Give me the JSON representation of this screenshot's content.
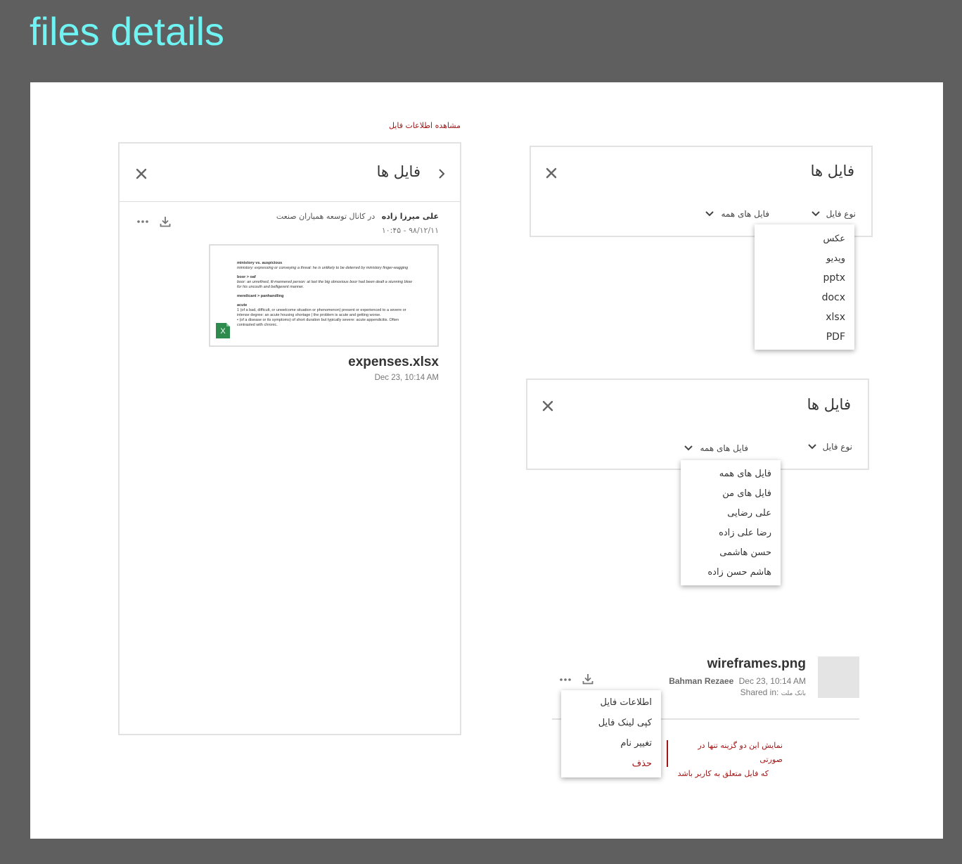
{
  "page_title": "files details",
  "annotation_view_info": "مشاهده اطلاعات فایل",
  "left_panel": {
    "title": "فایل ها",
    "sender_name": "علی میرزا زاده",
    "channel_text": "در کانال توسعه همیاران صنعت",
    "datetime": "۹۸/۱۲/۱۱ - ۱۰:۴۵",
    "preview_lines": [
      "ministory vs. auspicious",
      "ministory: expressing or conveying a threat: he is unlikely to be deterred by ministory finger-wagging",
      "boor > oaf",
      "boor: an unrefined, ill-mannered person: at last the big obnoxious boor had been dealt a stunning blow for his uncouth and belligerent manner.",
      "mendicant > panhandling",
      "acute",
      "1 (of a bad, difficult, or unwelcome situation or phenomenon) present or experienced to a severe or intense degree: an acute housing shortage | the problem is acute and getting worse.",
      "• (of a disease or its symptoms) of short duration but typically severe: acute appendicitis. Often contrasted with chronic."
    ],
    "file_badge": "X",
    "file_name": "expenses.xlsx",
    "file_date": "Dec 23, 10:14 AM"
  },
  "filter_panel_1": {
    "title": "فایل ها",
    "file_type_label": "نوع فایل",
    "sender_label": "فایل های همه",
    "type_options": [
      "عکس",
      "ویدیو",
      "pptx",
      "docx",
      "xlsx",
      "PDF"
    ]
  },
  "filter_panel_2": {
    "title": "فایل ها",
    "file_type_label": "نوع فایل",
    "sender_label": "فایل های همه",
    "sender_options": [
      "فایل های همه",
      "فایل های من",
      "علی رضایی",
      "رضا علی زاده",
      "حسن هاشمی",
      "هاشم حسن زاده"
    ]
  },
  "file_item": {
    "file_name": "wireframes.png",
    "author": "Bahman Rezaee",
    "date": "Dec 23, 10:14 AM",
    "shared_in_label": "Shared in:",
    "shared_in_value": "بانک ملت",
    "context_menu": [
      "اطلاعات فایل",
      "کپی لینک فایل",
      "تغییر نام",
      "حذف"
    ],
    "note_line1": "نمایش این دو گزینه تنها در صورتی",
    "note_line2": "که فایل متعلق به کاربر باشد"
  },
  "icons": {
    "close": "close-icon",
    "back": "chevron-right-icon",
    "more": "more-horizontal-icon",
    "download": "download-icon",
    "dropdown": "chevron-down-icon"
  },
  "colors": {
    "background": "#5f5f5f",
    "canvas": "#ffffff",
    "title_cyan": "#6ff3f3",
    "annotation_red": "#a31515",
    "excel_green": "#2e8b4e"
  }
}
